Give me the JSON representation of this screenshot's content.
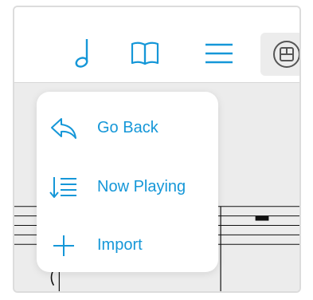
{
  "colors": {
    "accent": "#1597d8",
    "popover_bg": "#ffffff",
    "sheet_bg": "#ececec",
    "staff_line": "#111111"
  },
  "toolbar": {
    "icons": [
      "music-note-icon",
      "book-icon",
      "hamburger-menu-icon",
      "layout-icon"
    ]
  },
  "menu": {
    "items": [
      {
        "label": "Go Back",
        "icon": "go-back-arrow-icon"
      },
      {
        "label": "Now Playing",
        "icon": "now-playing-list-icon"
      },
      {
        "label": "Import",
        "icon": "plus-icon"
      }
    ]
  }
}
